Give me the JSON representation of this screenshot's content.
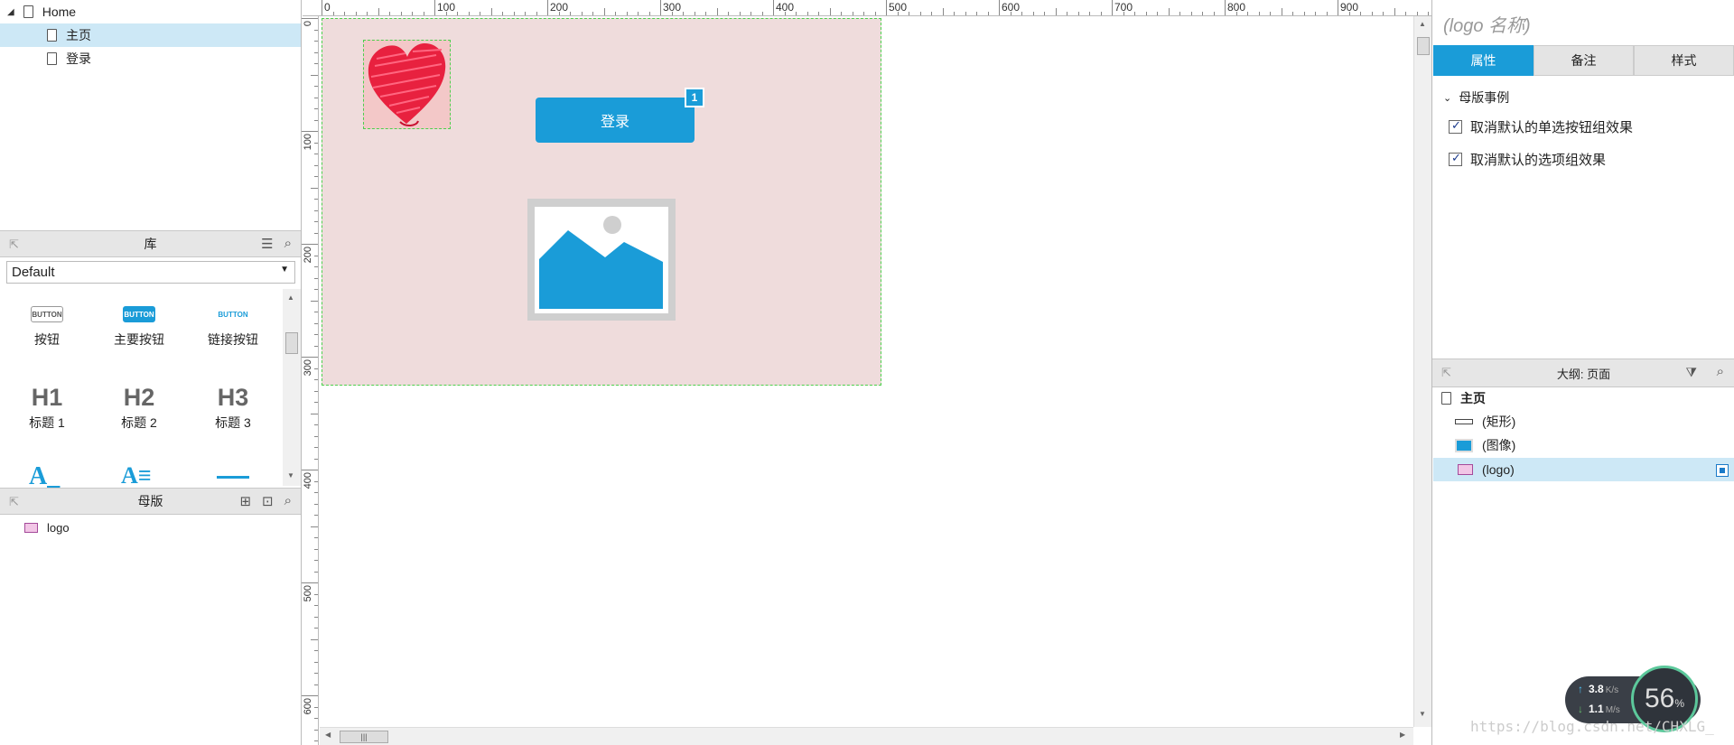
{
  "pages_tree": {
    "root": "Home",
    "pages": [
      "主页",
      "登录"
    ]
  },
  "library": {
    "title": "库",
    "dropdown_value": "Default",
    "widgets": [
      {
        "thumb": "BUTTON",
        "label": "按钮"
      },
      {
        "thumb": "BUTTON",
        "label": "主要按钮"
      },
      {
        "thumb": "BUTTON",
        "label": "链接按钮"
      },
      {
        "thumb": "H1",
        "label": "标题 1"
      },
      {
        "thumb": "H2",
        "label": "标题 2"
      },
      {
        "thumb": "H3",
        "label": "标题 3"
      }
    ]
  },
  "masters": {
    "title": "母版",
    "items": [
      "logo"
    ]
  },
  "ruler": {
    "h_labels": [
      "0",
      "100",
      "200",
      "300",
      "400",
      "500",
      "600",
      "700",
      "800",
      "900"
    ],
    "v_labels": [
      "0",
      "100",
      "200",
      "300",
      "400",
      "500",
      "600"
    ]
  },
  "canvas": {
    "login_button": "登录",
    "badge": "1"
  },
  "inspector": {
    "title": "(logo 名称)",
    "tabs": [
      "属性",
      "备注",
      "样式"
    ],
    "section": "母版事例",
    "checkboxes": [
      "取消默认的单选按钮组效果",
      "取消默认的选项组效果"
    ]
  },
  "outline": {
    "title": "大纲: 页面",
    "root": "主页",
    "items": [
      "(矩形)",
      "(图像)",
      "(logo)"
    ]
  },
  "net_meter": {
    "up": "3.8",
    "up_unit": "K/s",
    "down": "1.1",
    "down_unit": "M/s",
    "percent": "56",
    "percent_sign": "%"
  },
  "watermark": "https://blog.csdn.net/CHXLG_"
}
